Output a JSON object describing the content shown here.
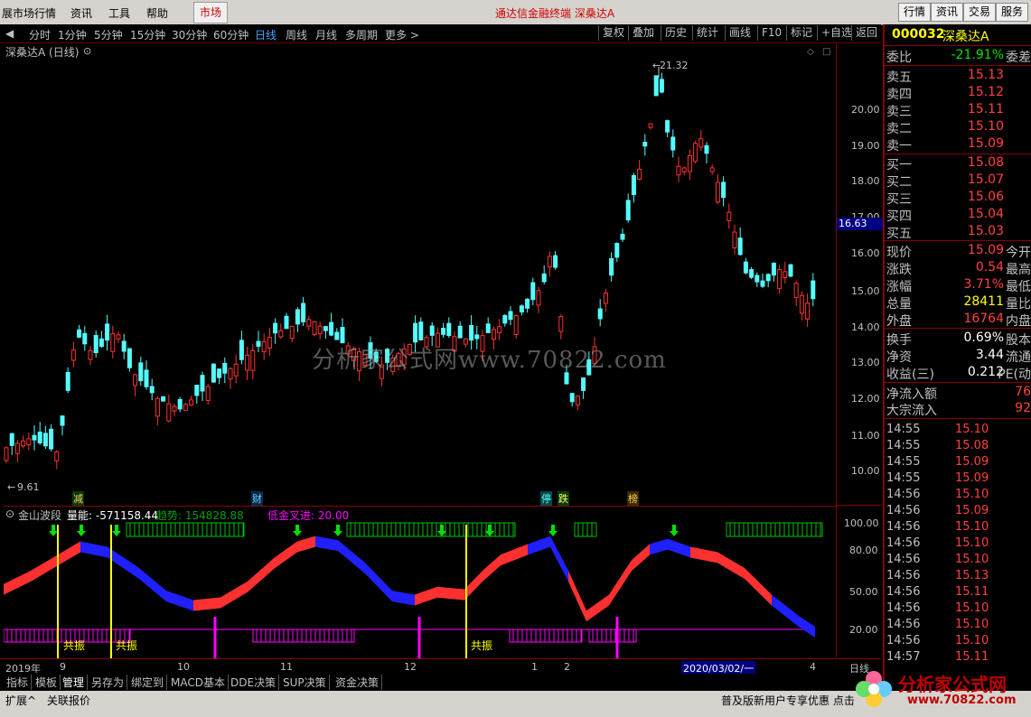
{
  "menubar": {
    "items": [
      "展市场行情",
      "资讯",
      "工具",
      "帮助"
    ],
    "market": "市场",
    "title": "通达信金融终端  深桑达A",
    "right_buttons": [
      "行情",
      "资讯",
      "交易",
      "服务"
    ]
  },
  "periods": {
    "items": [
      "分时",
      "1分钟",
      "5分钟",
      "15分钟",
      "30分钟",
      "60分钟",
      "日线",
      "周线",
      "月线",
      "多周期",
      "更多 >"
    ],
    "active": "日线",
    "tools": [
      "复权",
      "叠加",
      "历史",
      "统计",
      "画线",
      "F10",
      "标记",
      "+自选",
      "返回"
    ]
  },
  "chart": {
    "title": "深桑达A (日线)",
    "high_label": "21.32",
    "low_label": "9.61",
    "current_price": "16.63",
    "watermark": "分析家公式网www.70822.com",
    "yaxis": [
      "20.00",
      "19.00",
      "18.00",
      "17.00",
      "16.00",
      "15.00",
      "14.00",
      "13.00",
      "12.00",
      "11.00",
      "10.00"
    ],
    "markers": [
      "减",
      "财",
      "停",
      "跌",
      "榜"
    ]
  },
  "indicator": {
    "name": "金山波段",
    "liangneng": "量能: -571158.44",
    "qushi": "趋势: 154828.88",
    "dijin": "低金叉进: 20.00",
    "yaxis": [
      "100.00",
      "80.00",
      "50.00",
      "20.00"
    ],
    "resonance": "共振"
  },
  "timeaxis": {
    "labels": [
      "2019年",
      "9",
      "10",
      "11",
      "12",
      "1",
      "2",
      "4"
    ],
    "cursor": "2020/03/02/一",
    "right": "日线"
  },
  "tabs": [
    "指标",
    "模板",
    "管理",
    "另存为",
    "绑定到",
    "MACD基本",
    "DDE决策",
    "SUP决策",
    "资金决策"
  ],
  "status": {
    "left": [
      "扩展^",
      "关联报价"
    ],
    "right": "普及版新用户专享优惠  点击"
  },
  "quote": {
    "code": "000032",
    "name": "深桑达A",
    "weibi_label": "委比",
    "weibi_value": "-21.91%",
    "weicha_label": "委差",
    "asks": [
      {
        "label": "卖五",
        "price": "15.13"
      },
      {
        "label": "卖四",
        "price": "15.12"
      },
      {
        "label": "卖三",
        "price": "15.11"
      },
      {
        "label": "卖二",
        "price": "15.10"
      },
      {
        "label": "卖一",
        "price": "15.09"
      }
    ],
    "bids": [
      {
        "label": "买一",
        "price": "15.08"
      },
      {
        "label": "买二",
        "price": "15.07"
      },
      {
        "label": "买三",
        "price": "15.06"
      },
      {
        "label": "买四",
        "price": "15.04"
      },
      {
        "label": "买五",
        "price": "15.03"
      }
    ],
    "stats": [
      {
        "label": "现价",
        "value": "15.09",
        "ext": "今开",
        "color": "red"
      },
      {
        "label": "涨跌",
        "value": "0.54",
        "ext": "最高",
        "color": "red"
      },
      {
        "label": "涨幅",
        "value": "3.71%",
        "ext": "最低",
        "color": "red"
      },
      {
        "label": "总量",
        "value": "28411",
        "ext": "量比",
        "color": "yellow"
      },
      {
        "label": "外盘",
        "value": "16764",
        "ext": "内盘",
        "color": "red"
      }
    ],
    "stats2": [
      {
        "label": "换手",
        "value": "0.69%",
        "ext": "股本",
        "color": "white"
      },
      {
        "label": "净资",
        "value": "3.44",
        "ext": "流通",
        "color": "white"
      },
      {
        "label": "收益(三)",
        "value": "0.212",
        "ext": "PE(动",
        "color": "white"
      }
    ],
    "flows": [
      {
        "label": "净流入额",
        "value": "76"
      },
      {
        "label": "大宗流入",
        "value": "92"
      }
    ],
    "ticks": [
      {
        "time": "14:55",
        "price": "15.10"
      },
      {
        "time": "14:55",
        "price": "15.08"
      },
      {
        "time": "14:55",
        "price": "15.09"
      },
      {
        "time": "14:55",
        "price": "15.09"
      },
      {
        "time": "14:56",
        "price": "15.10"
      },
      {
        "time": "14:56",
        "price": "15.09"
      },
      {
        "time": "14:56",
        "price": "15.10"
      },
      {
        "time": "14:56",
        "price": "15.10"
      },
      {
        "time": "14:56",
        "price": "15.10"
      },
      {
        "time": "14:56",
        "price": "15.13"
      },
      {
        "time": "14:56",
        "price": "15.11"
      },
      {
        "time": "14:56",
        "price": "15.10"
      },
      {
        "time": "14:56",
        "price": "15.10"
      },
      {
        "time": "14:56",
        "price": "15.10"
      },
      {
        "time": "14:57",
        "price": "15.11"
      }
    ]
  },
  "logo": {
    "text": "分析家公式网",
    "url": "www.70822.com"
  }
}
